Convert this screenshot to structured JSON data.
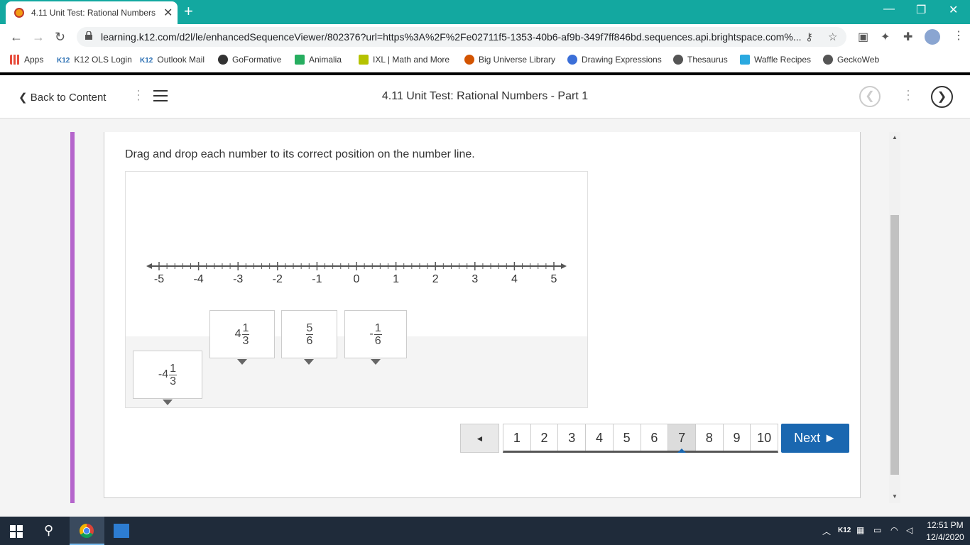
{
  "browser": {
    "tab_title": "4.11 Unit Test: Rational Numbers",
    "url": "learning.k12.com/d2l/le/enhancedSequenceViewer/802376?url=https%3A%2F%2Fe02711f5-1353-40b6-af9b-349f7ff846bd.sequences.api.brightspace.com%...",
    "bookmarks": [
      {
        "label": "Apps",
        "color": "#e74c3c"
      },
      {
        "label": "K12 OLS Login",
        "color": "#2a6fb3",
        "prefix": "K12"
      },
      {
        "label": "Outlook Mail",
        "color": "#2a6fb3",
        "prefix": "K12"
      },
      {
        "label": "GoFormative",
        "color": "#333333"
      },
      {
        "label": "Animalia",
        "color": "#27ae60"
      },
      {
        "label": "IXL | Math and More",
        "color": "#b5c200"
      },
      {
        "label": "Big Universe Library",
        "color": "#d35400"
      },
      {
        "label": "Drawing Expressions",
        "color": "#3b6fd8"
      },
      {
        "label": "Thesaurus",
        "color": "#555555"
      },
      {
        "label": "Waffle Recipes",
        "color": "#2aa9e0"
      },
      {
        "label": "GeckoWeb",
        "color": "#555555"
      }
    ]
  },
  "lms": {
    "back_label": "Back to Content",
    "page_title": "4.11 Unit Test: Rational Numbers - Part 1"
  },
  "question": {
    "instruction": "Drag and drop each number to its correct position on the number line.",
    "number_line": {
      "min": -5,
      "max": 5,
      "ticks_per_unit": 5,
      "labels": [
        "-5",
        "-4",
        "-3",
        "-2",
        "-1",
        "0",
        "1",
        "2",
        "3",
        "4",
        "5"
      ]
    },
    "cards": [
      {
        "id": "neg-4-1-3",
        "sign": "-",
        "whole": "4",
        "num": "1",
        "den": "3"
      },
      {
        "id": "pos-4-1-3",
        "sign": "",
        "whole": "4",
        "num": "1",
        "den": "3"
      },
      {
        "id": "pos-5-6",
        "sign": "",
        "whole": "",
        "num": "5",
        "den": "6"
      },
      {
        "id": "neg-1-6",
        "sign": "-",
        "whole": "",
        "num": "1",
        "den": "6"
      }
    ]
  },
  "pager": {
    "prev_label": "◄",
    "pages": [
      "1",
      "2",
      "3",
      "4",
      "5",
      "6",
      "7",
      "8",
      "9",
      "10"
    ],
    "current": "7",
    "next_label": "Next ►"
  },
  "taskbar": {
    "time": "12:51 PM",
    "date": "12/4/2020",
    "k12_tray": "K12"
  }
}
